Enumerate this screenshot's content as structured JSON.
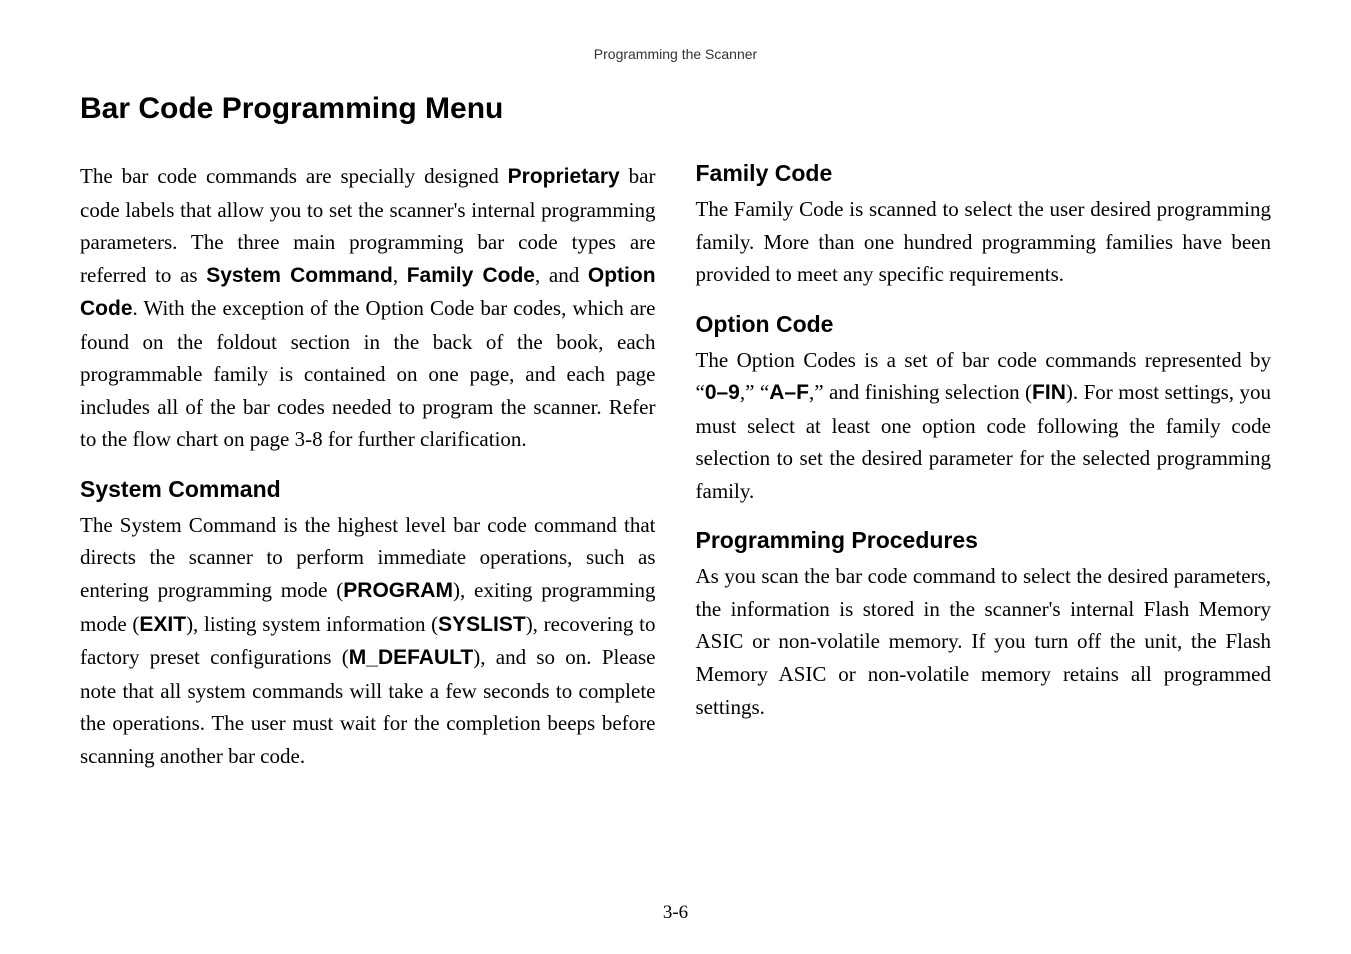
{
  "header": "Programming the Scanner",
  "title": "Bar Code Programming Menu",
  "intro": {
    "part1": "The bar code commands are specially designed ",
    "b1": "Proprietary",
    "part2": " bar code labels that allow you to set the scanner's internal programming parameters. The three main programming bar code types are referred to as ",
    "b2": "System Command",
    "part3": ", ",
    "b3": "Family Code",
    "part4": ", and ",
    "b4": "Option Code",
    "part5": ". With the exception of the Option Code bar codes, which are found on the foldout section in the back of the book, each programmable family is contained on one page, and each page includes all of the bar codes needed to program the scanner. Refer to the flow chart on page 3-8 for further clarification."
  },
  "system_command": {
    "heading": "System Command",
    "p1": "The System Command is the highest level bar code command that directs the scanner to perform immediate operations, such as entering programming mode (",
    "b1": "PROGRAM",
    "p2": "), exiting programming mode (",
    "b2": "EXIT",
    "p3": "), listing system information (",
    "b3": "SYSLIST",
    "p4": "), recovering to factory preset configurations (",
    "b4": "M_DEFAULT",
    "p5": "), and so on. Please note that all system commands will take a few seconds to complete the operations. The user must wait for the completion beeps before scanning another bar code."
  },
  "family_code": {
    "heading": "Family Code",
    "text": "The Family Code is scanned to select the user desired programming family. More than one hundred programming families have been provided to meet any specific requirements."
  },
  "option_code": {
    "heading": "Option Code",
    "p1": "The Option Codes is a set of bar code commands represented by “",
    "b1": "0–9",
    "p2": ",” “",
    "b2": "A–F",
    "p3": ",” and finishing selection (",
    "b3": "FIN",
    "p4": "). For most settings, you must select at least one option code following the family code selection to set the desired parameter for the selected programming family."
  },
  "programming_procedures": {
    "heading": "Programming Procedures",
    "text": "As you scan the bar code command to select the desired parameters, the information is stored in the scanner's internal Flash Memory ASIC or non-volatile memory. If you turn off the unit, the Flash Memory ASIC or non-volatile memory retains all programmed settings."
  },
  "page_number": "3-6"
}
